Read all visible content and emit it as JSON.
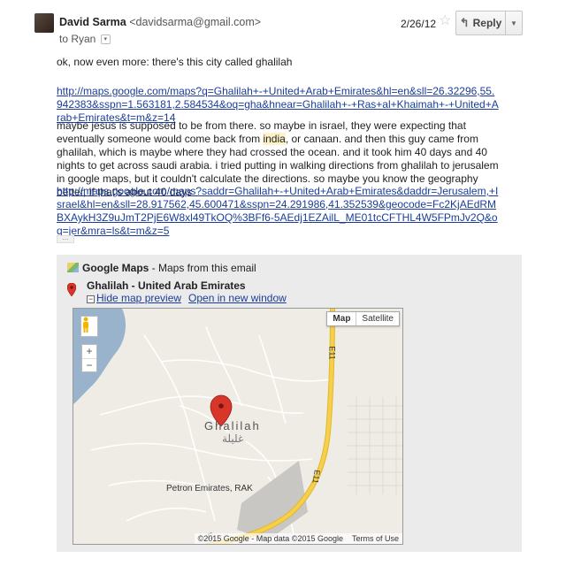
{
  "header": {
    "sender_name": "David Sarma",
    "sender_email": "<davidsarma@gmail.com>",
    "to_line": "to Ryan",
    "date": "2/26/12",
    "reply_label": "Reply"
  },
  "message": {
    "p1": "ok, now even more: there's this city called ghalilah",
    "link1": "http://maps.google.com/maps?q=Ghalilah+-+United+Arab+Emirates&hl=en&sll=26.32296,55.942383&sspn=1.563181,2.584534&oq=gha&hnear=Ghalilah+-+Ras+al+Khaimah+-+United+Arab+Emirates&t=m&z=14",
    "p3_before": "maybe jesus is supposed to be from there. so maybe in israel, they were expecting that eventually someone would come back from ",
    "p3_highlight": "india",
    "p3_after": ", or canaan. and then this guy came from ghalilah, which is maybe where they had crossed the ocean. and it took him 40 days and 40 nights to get across saudi arabia. i tried putting in walking directions from ghalilah to jerusalem in google maps, but it couldn't calculate the directions. so maybe you know the geography better, if that's about 40 days",
    "link2": "http://maps.google.com/maps?saddr=Ghalilah+-+United+Arab+Emirates&daddr=Jerusalem,+Israel&hl=en&sll=28.917562,45.600471&sspn=24.291986,41.352539&geocode=Fc2KjAEdRMBXAykH3Z9uJmT2PjE6W8xl49TkOQ%3BFf6-5AEdj1EZAilL_ME01tcCFTHL4W5FPmJv2Q&oq=jer&mra=ls&t=m&z=5",
    "ellipsis": "..."
  },
  "maps_panel": {
    "brand": "Google Maps",
    "subtitle": " - Maps from this email",
    "place_title": "Ghalilah - United Arab Emirates",
    "hide_link": "Hide map preview",
    "open_link": "Open in new window",
    "map_type_selected": "Map",
    "map_type_other": "Satellite",
    "zoom_in": "+",
    "zoom_out": "−",
    "city_label": "Ghalilah",
    "city_label_ar": "غليلة",
    "poi_label": "Petron Emirates, RAK",
    "road_label": "E11",
    "road_label_cut": "E",
    "attribution": "©2015 Google - Map data ©2015 Google",
    "terms": "Terms of Use",
    "colors": {
      "water": "#99b3cc",
      "highway": "#f6d04b",
      "marker": "#d8352b",
      "land": "#efece6"
    }
  }
}
